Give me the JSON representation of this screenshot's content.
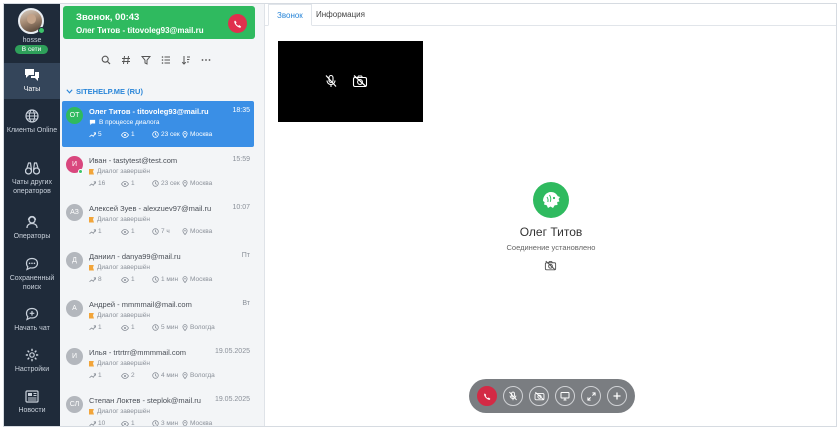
{
  "sidebar": {
    "username": "hosse",
    "status": "В сети",
    "items": [
      {
        "label": "Чаты",
        "icon": "chat-bubbles-icon"
      },
      {
        "label": "Клиенты Online",
        "icon": "globe-icon"
      },
      {
        "label": "Чаты других операторов",
        "icon": "binoculars-icon"
      },
      {
        "label": "Операторы",
        "icon": "operator-headset-icon"
      },
      {
        "label": "Сохраненный поиск",
        "icon": "saved-search-icon"
      },
      {
        "label": "Начать чат",
        "icon": "start-chat-icon"
      },
      {
        "label": "Настройки",
        "icon": "gear-icon"
      },
      {
        "label": "Новости",
        "icon": "news-icon"
      }
    ]
  },
  "call_banner": {
    "title": "Звонок, 00:43",
    "subtitle": "Олег Титов - titovoleg93@mail.ru"
  },
  "list": {
    "group": "SITEHELP.ME (RU)",
    "conversations": [
      {
        "initials": "ОТ",
        "avatar_color": "#2fba5f",
        "name": "Олег Титов - titovoleg93@mail.ru",
        "time": "18:35",
        "status": "В процессе диалога",
        "messages": "5",
        "views": "1",
        "duration": "23 сек",
        "city": "Москва",
        "online": false,
        "active": true
      },
      {
        "initials": "И",
        "avatar_color": "#d9477e",
        "name": "Иван - tastytest@test.com",
        "time": "15:59",
        "status": "Диалог завершён",
        "messages": "16",
        "views": "1",
        "duration": "23 сек",
        "city": "Москва",
        "online": true,
        "active": false
      },
      {
        "initials": "АЗ",
        "avatar_color": "#b3b7bd",
        "name": "Алексей Зуев - alexzuev97@mail.ru",
        "time": "10:07",
        "status": "Диалог завершён",
        "messages": "1",
        "views": "1",
        "duration": "7 ч",
        "city": "Москва",
        "online": false,
        "active": false
      },
      {
        "initials": "Д",
        "avatar_color": "#b3b7bd",
        "name": "Даниил - danya99@mail.ru",
        "time": "Пт",
        "status": "Диалог завершён",
        "messages": "8",
        "views": "1",
        "duration": "1 мин",
        "city": "Москва",
        "online": false,
        "active": false
      },
      {
        "initials": "А",
        "avatar_color": "#b3b7bd",
        "name": "Андрей - mmmmail@mail.com",
        "time": "Вт",
        "status": "Диалог завершён",
        "messages": "1",
        "views": "1",
        "duration": "5 мин",
        "city": "Вологда",
        "online": false,
        "active": false
      },
      {
        "initials": "И",
        "avatar_color": "#b3b7bd",
        "name": "Илья - trtrtrr@mmmmail.com",
        "time": "19.05.2025",
        "status": "Диалог завершён",
        "messages": "1",
        "views": "2",
        "duration": "4 мин",
        "city": "Вологда",
        "online": false,
        "active": false
      },
      {
        "initials": "СЛ",
        "avatar_color": "#b3b7bd",
        "name": "Степан Локтев - steplok@mail.ru",
        "time": "19.05.2025",
        "status": "Диалог завершён",
        "messages": "10",
        "views": "1",
        "duration": "3 мин",
        "city": "Москва",
        "online": false,
        "active": false
      }
    ]
  },
  "tabs": [
    {
      "label": "Звонок",
      "active": true
    },
    {
      "label": "Информация",
      "active": false
    }
  ],
  "call": {
    "peer_name": "Олег Титов",
    "connection_status": "Соединение установлено"
  },
  "colors": {
    "sidebar_bg": "#1f2b3a",
    "accent_green": "#2fba5f",
    "accent_blue": "#3a8fe6",
    "hangup_red": "#d32a45"
  }
}
